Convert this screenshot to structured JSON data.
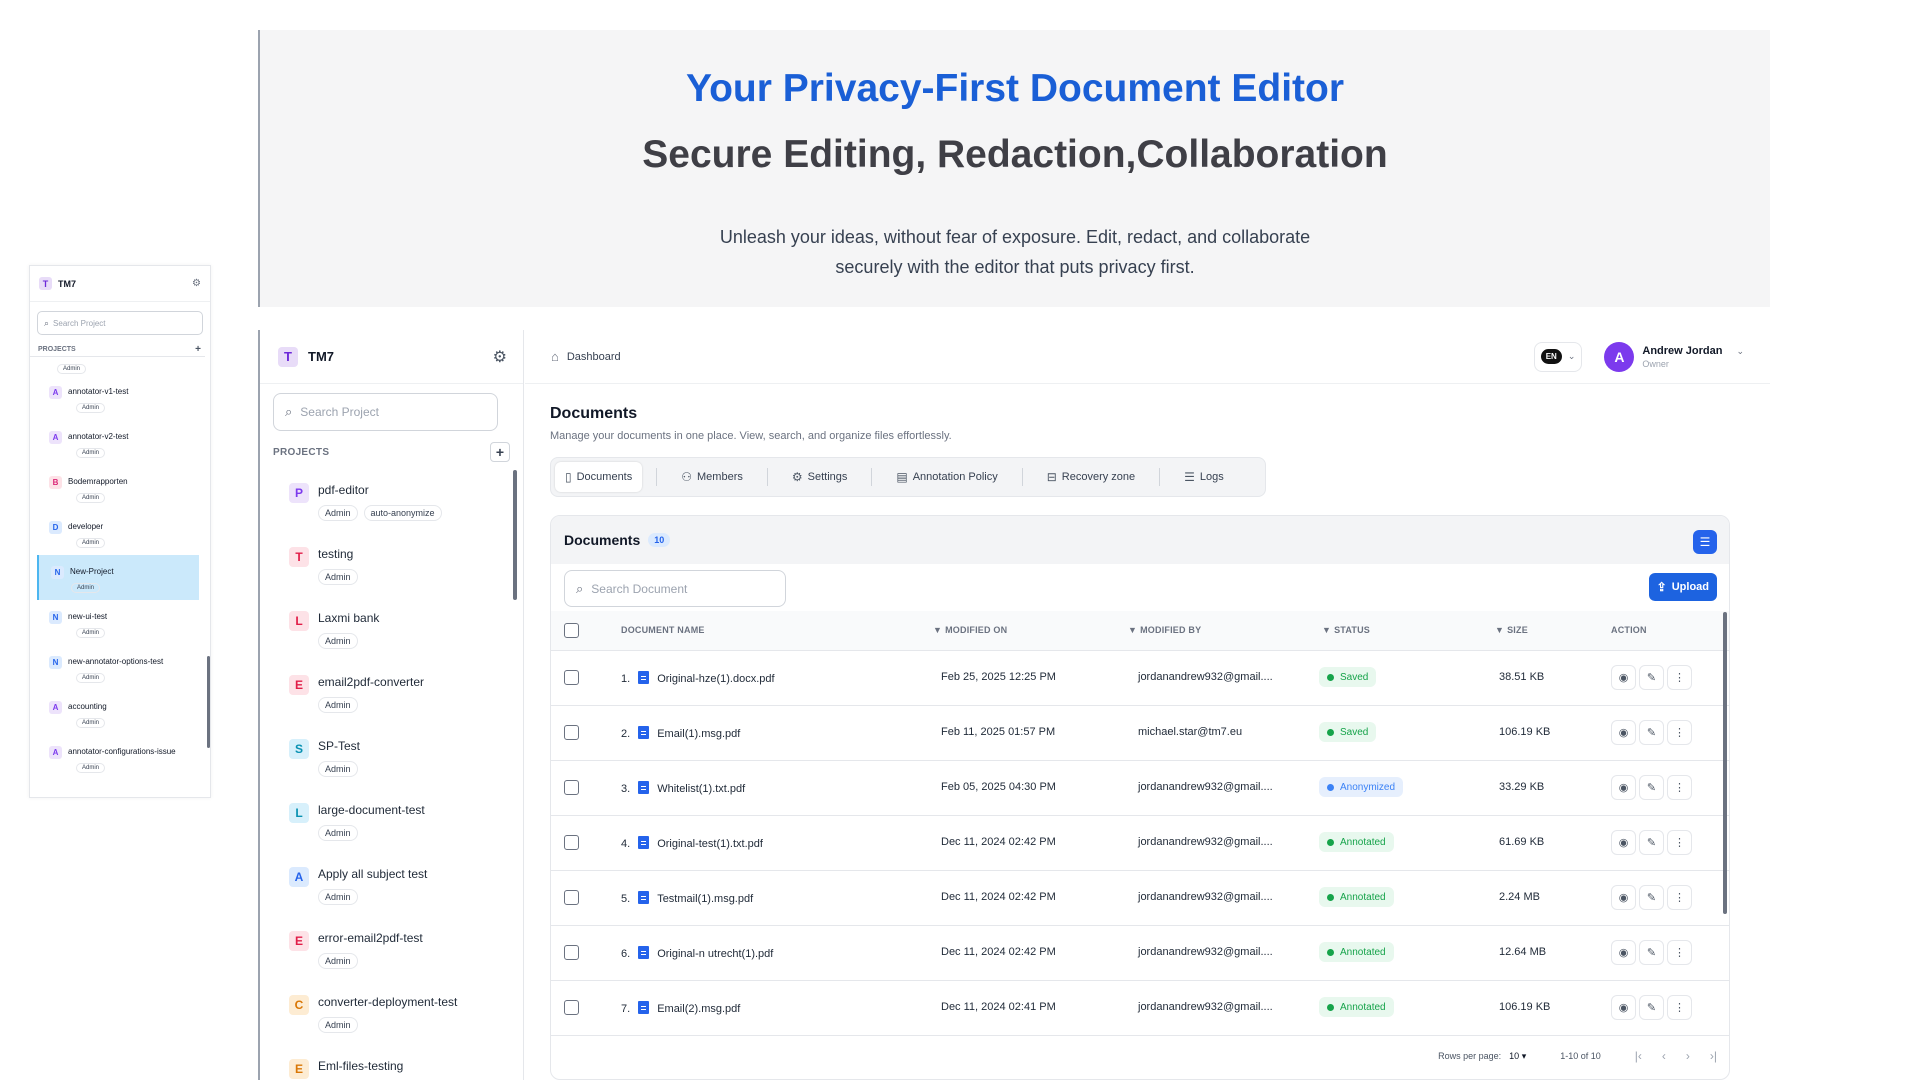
{
  "hero": {
    "title": "Your Privacy-First Document Editor",
    "subtitle": "Secure Editing, Redaction,Collaboration",
    "desc_line1": "Unleash your ideas, without fear of exposure. Edit, redact, and collaborate",
    "desc_line2": "securely with the editor that puts privacy first."
  },
  "mini": {
    "app_name": "TM7",
    "logo_letter": "T",
    "search_placeholder": "Search Project",
    "projects_label": "PROJECTS",
    "items": [
      {
        "letter": "A",
        "label": "annotator-v1-test",
        "badge": "Admin",
        "bg": "#ede3fb",
        "fg": "#7c3aed"
      },
      {
        "letter": "A",
        "label": "annotator-v2-test",
        "badge": "Admin",
        "bg": "#ede3fb",
        "fg": "#7c3aed"
      },
      {
        "letter": "B",
        "label": "Bodemrapporten",
        "badge": "Admin",
        "bg": "#fde2e7",
        "fg": "#db2777"
      },
      {
        "letter": "D",
        "label": "developer",
        "badge": "Admin",
        "bg": "#dbeafe",
        "fg": "#2563eb"
      },
      {
        "letter": "N",
        "label": "New-Project",
        "badge": "Admin",
        "bg": "#dbeafe",
        "fg": "#2563eb"
      },
      {
        "letter": "N",
        "label": "new-ui-test",
        "badge": "Admin",
        "bg": "#dbeafe",
        "fg": "#2563eb"
      },
      {
        "letter": "N",
        "label": "new-annotator-options-test",
        "badge": "Admin",
        "bg": "#dbeafe",
        "fg": "#2563eb"
      },
      {
        "letter": "A",
        "label": "accounting",
        "badge": "Admin",
        "bg": "#ede3fb",
        "fg": "#7c3aed"
      },
      {
        "letter": "A",
        "label": "annotator-configurations-issue",
        "badge": "Admin",
        "bg": "#ede3fb",
        "fg": "#7c3aed"
      }
    ],
    "partial_badge": "Admin"
  },
  "sidebar": {
    "app_name": "TM7",
    "logo_letter": "T",
    "search_placeholder": "Search Project",
    "projects_label": "PROJECTS",
    "add_icon": "+",
    "items": [
      {
        "letter": "P",
        "label": "pdf-editor",
        "badges": [
          "Admin",
          "auto-anonymize"
        ],
        "bg": "#ede3fb",
        "fg": "#7c3aed"
      },
      {
        "letter": "T",
        "label": "testing",
        "badges": [
          "Admin"
        ],
        "bg": "#fde2e7",
        "fg": "#e11d48"
      },
      {
        "letter": "L",
        "label": "Laxmi bank",
        "badges": [
          "Admin"
        ],
        "bg": "#fde2e7",
        "fg": "#e11d48"
      },
      {
        "letter": "E",
        "label": "email2pdf-converter",
        "badges": [
          "Admin"
        ],
        "bg": "#fde2e7",
        "fg": "#e11d48"
      },
      {
        "letter": "S",
        "label": "SP-Test",
        "badges": [
          "Admin"
        ],
        "bg": "#d7f0fb",
        "fg": "#0891b2"
      },
      {
        "letter": "L",
        "label": "large-document-test",
        "badges": [
          "Admin"
        ],
        "bg": "#d7f0fb",
        "fg": "#0891b2"
      },
      {
        "letter": "A",
        "label": "Apply all subject test",
        "badges": [
          "Admin"
        ],
        "bg": "#dbeafe",
        "fg": "#2563eb"
      },
      {
        "letter": "E",
        "label": "error-email2pdf-test",
        "badges": [
          "Admin"
        ],
        "bg": "#fde2e7",
        "fg": "#e11d48"
      },
      {
        "letter": "C",
        "label": "converter-deployment-test",
        "badges": [
          "Admin"
        ],
        "bg": "#fdecd3",
        "fg": "#d97706"
      },
      {
        "letter": "E",
        "label": "Eml-files-testing",
        "badges": [],
        "bg": "#fdecd3",
        "fg": "#d97706"
      }
    ]
  },
  "topbar": {
    "breadcrumb": "Dashboard",
    "lang": "EN",
    "user_initial": "A",
    "user_name": "Andrew Jordan",
    "user_role": "Owner"
  },
  "page": {
    "title": "Documents",
    "description": "Manage your documents in one place. View, search, and organize files effortlessly."
  },
  "tabs": [
    {
      "icon": "document-icon",
      "glyph": "▯",
      "label": "Documents",
      "active": true
    },
    {
      "icon": "members-icon",
      "glyph": "⚇",
      "label": "Members",
      "active": false
    },
    {
      "icon": "settings-icon",
      "glyph": "⚙",
      "label": "Settings",
      "active": false
    },
    {
      "icon": "policy-icon",
      "glyph": "▤",
      "label": "Annotation Policy",
      "active": false
    },
    {
      "icon": "archive-icon",
      "glyph": "⊟",
      "label": "Recovery zone",
      "active": false
    },
    {
      "icon": "list-icon",
      "glyph": "☰",
      "label": "Logs",
      "active": false
    }
  ],
  "documents": {
    "title": "Documents",
    "count": "10",
    "search_placeholder": "Search Document",
    "upload_label": "Upload",
    "columns": {
      "name": "DOCUMENT NAME",
      "modified_on": "MODIFIED ON",
      "modified_by": "MODIFIED BY",
      "status": "STATUS",
      "size": "SIZE",
      "action": "ACTION"
    },
    "rows": [
      {
        "num": "1.",
        "name": "Original-hze(1).docx.pdf",
        "modified_on": "Feb 25, 2025 12:25 PM",
        "modified_by": "jordanandrew932@gmail....",
        "status": "Saved",
        "status_kind": "green",
        "size": "38.51 KB"
      },
      {
        "num": "2.",
        "name": "Email(1).msg.pdf",
        "modified_on": "Feb 11, 2025 01:57 PM",
        "modified_by": "michael.star@tm7.eu",
        "status": "Saved",
        "status_kind": "green",
        "size": "106.19 KB"
      },
      {
        "num": "3.",
        "name": "Whitelist(1).txt.pdf",
        "modified_on": "Feb 05, 2025 04:30 PM",
        "modified_by": "jordanandrew932@gmail....",
        "status": "Anonymized",
        "status_kind": "blue",
        "size": "33.29 KB"
      },
      {
        "num": "4.",
        "name": "Original-test(1).txt.pdf",
        "modified_on": "Dec 11, 2024 02:42 PM",
        "modified_by": "jordanandrew932@gmail....",
        "status": "Annotated",
        "status_kind": "green",
        "size": "61.69 KB"
      },
      {
        "num": "5.",
        "name": "Testmail(1).msg.pdf",
        "modified_on": "Dec 11, 2024 02:42 PM",
        "modified_by": "jordanandrew932@gmail....",
        "status": "Annotated",
        "status_kind": "green",
        "size": "2.24 MB"
      },
      {
        "num": "6.",
        "name": "Original-n utrecht(1).pdf",
        "modified_on": "Dec 11, 2024 02:42 PM",
        "modified_by": "jordanandrew932@gmail....",
        "status": "Annotated",
        "status_kind": "green",
        "size": "12.64 MB"
      },
      {
        "num": "7.",
        "name": "Email(2).msg.pdf",
        "modified_on": "Dec 11, 2024 02:41 PM",
        "modified_by": "jordanandrew932@gmail....",
        "status": "Annotated",
        "status_kind": "green",
        "size": "106.19 KB"
      }
    ],
    "pager": {
      "rows_label": "Rows per page:",
      "rows_value": "10",
      "range": "1-10 of 10"
    }
  },
  "colors": {
    "hero_title": "#1a5fd6",
    "primary": "#1d63e0",
    "status_green": "#16a34a",
    "status_blue": "#3b82f6"
  }
}
